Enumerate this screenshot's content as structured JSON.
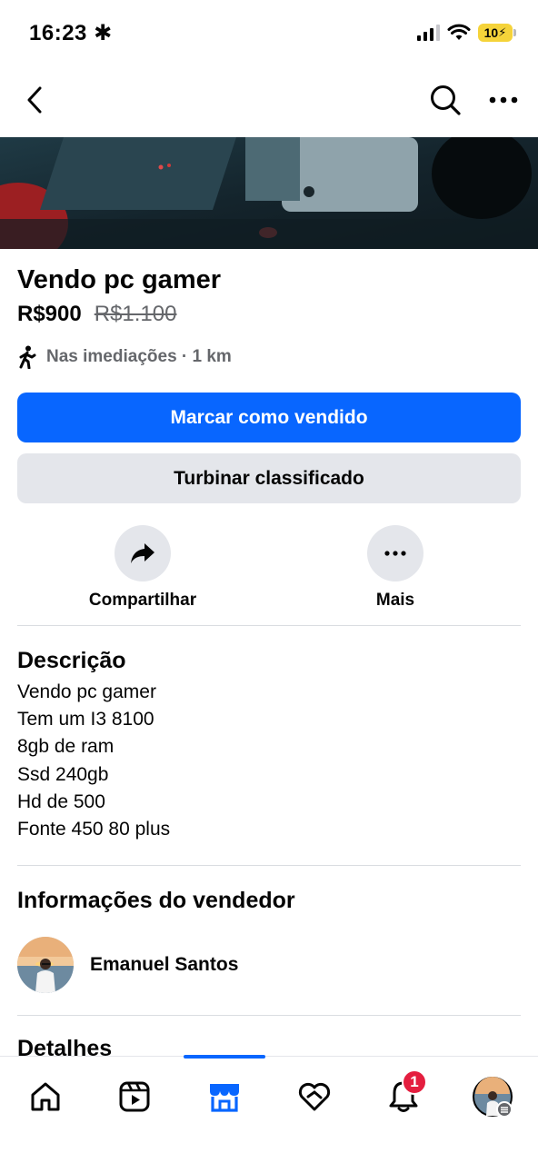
{
  "status_bar": {
    "time": "16:23",
    "battery": "10"
  },
  "nav": {
    "back_icon": "chevron-left-icon",
    "search_icon": "search-icon",
    "more_icon": "more-horizontal-icon"
  },
  "listing": {
    "title": "Vendo pc gamer",
    "price": "R$900",
    "old_price": "R$1.100",
    "location": "Nas imediações · 1 km"
  },
  "buttons": {
    "mark_sold": "Marcar como vendido",
    "boost": "Turbinar classificado"
  },
  "actions": [
    {
      "label": "Compartilhar",
      "icon": "share-icon"
    },
    {
      "label": "Mais",
      "icon": "more-horizontal-icon"
    }
  ],
  "description": {
    "title": "Descrição",
    "lines": [
      "Vendo pc gamer",
      "Tem um I3 8100",
      "8gb de ram",
      "Ssd 240gb",
      "Hd de 500",
      "Fonte 450 80 plus"
    ]
  },
  "seller": {
    "title": "Informações do vendedor",
    "name": "Emanuel Santos"
  },
  "details": {
    "title": "Detalhes"
  },
  "tab_bar": {
    "tabs": [
      "home-icon",
      "reels-icon",
      "marketplace-icon",
      "dating-icon",
      "notifications-icon",
      "profile-icon"
    ],
    "active": "marketplace-icon",
    "notification_count": "1"
  },
  "colors": {
    "primary": "#0866ff",
    "secondary_bg": "#e4e6eb",
    "badge": "#e41e3f",
    "muted_text": "#65676b"
  }
}
